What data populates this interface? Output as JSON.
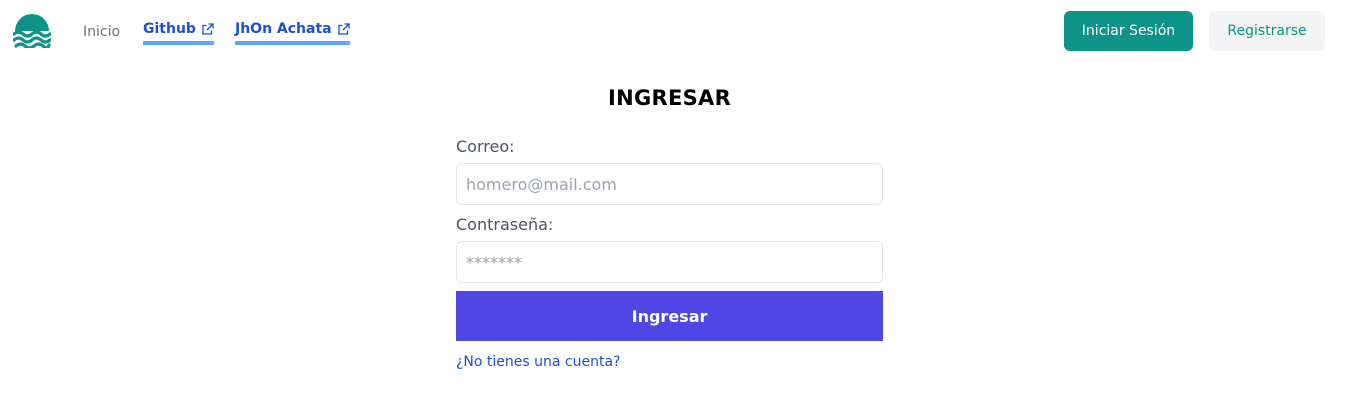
{
  "nav": {
    "home_label": "Inicio",
    "github_label": "Github",
    "jhon_label": "JhOn Achata",
    "login_label": "Iniciar Sesión",
    "register_label": "Registrarse"
  },
  "login_form": {
    "title": "INGRESAR",
    "email_label": "Correo:",
    "email_placeholder": "homero@mail.com",
    "email_value": "",
    "password_label": "Contraseña:",
    "password_placeholder": "*******",
    "password_value": "",
    "submit_label": "Ingresar",
    "signup_link": "¿No tienes una cuenta?"
  },
  "icons": {
    "logo": "waves-logo-icon",
    "external": "external-link-icon"
  },
  "colors": {
    "brand_teal": "#0d9488",
    "primary_indigo": "#4f46e5",
    "link_blue": "#1d4ed8",
    "link_underline": "#60a5fa",
    "secondary_bg": "#f3f4f6"
  }
}
